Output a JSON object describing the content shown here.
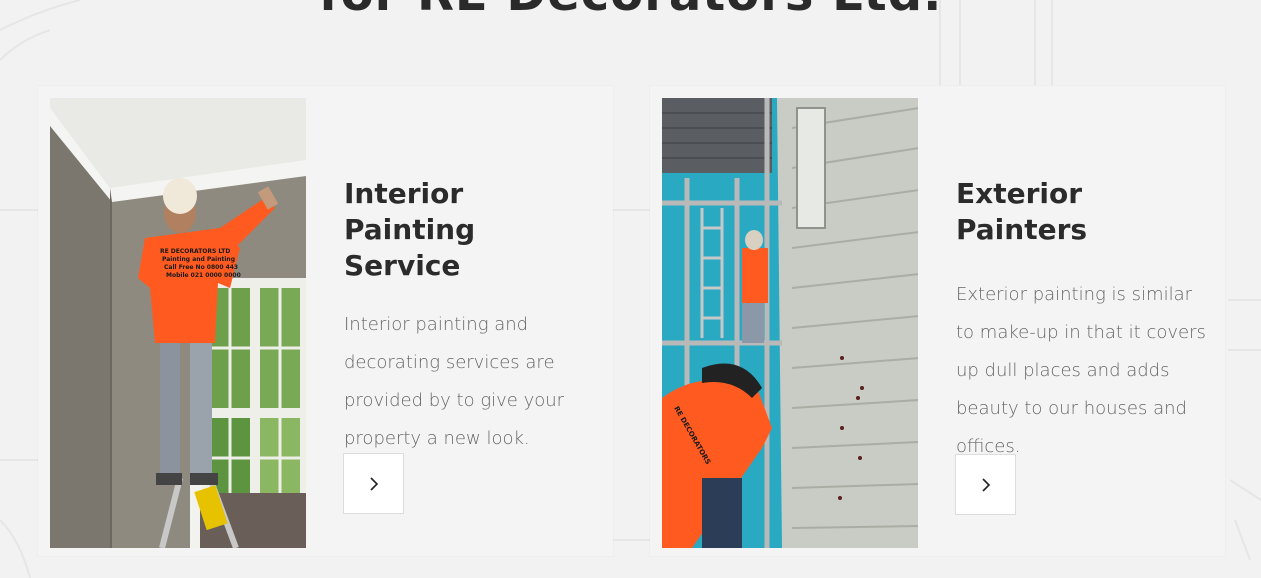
{
  "section": {
    "heading_partial": "for RE Decorators Ltd."
  },
  "cards": [
    {
      "title": "Interior Painting Service",
      "description": "Interior painting and decorating services are provided by to give your property a new look.",
      "photo_alt": "Painter in orange RE Decorators shirt painting interior ceiling cornice while standing on a ladder",
      "arrow_icon": "chevron-right-icon"
    },
    {
      "title": "Exterior Painters",
      "description": "Exterior painting is similar to make-up in that it covers up dull places and adds beauty to our houses and offices.",
      "photo_alt": "Painters in orange RE Decorators shirts working on scaffolding beside exterior weatherboard wall",
      "arrow_icon": "chevron-right-icon"
    }
  ],
  "colors": {
    "background": "#f2f2f2",
    "card_bg": "#f4f4f4",
    "title": "#2b2b2b",
    "text": "#666666",
    "shirt_orange": "#ff5a1f"
  }
}
